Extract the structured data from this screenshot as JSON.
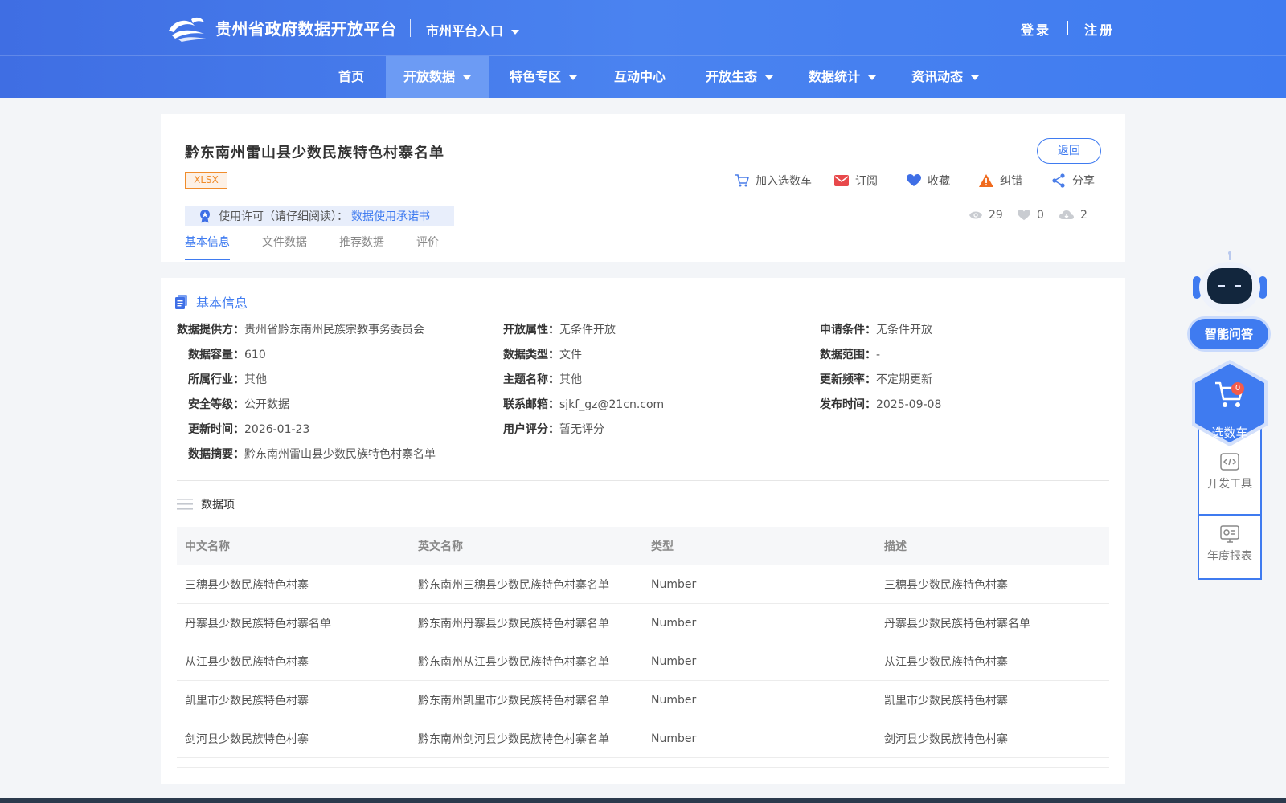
{
  "header": {
    "site_title": "贵州省政府数据开放平台",
    "city_entry": "市州平台入口",
    "login": "登录",
    "register": "注册"
  },
  "nav": {
    "items": [
      {
        "label": "首页",
        "has_dropdown": false,
        "active": false
      },
      {
        "label": "开放数据",
        "has_dropdown": true,
        "active": true
      },
      {
        "label": "特色专区",
        "has_dropdown": true,
        "active": false
      },
      {
        "label": "互动中心",
        "has_dropdown": false,
        "active": false
      },
      {
        "label": "开放生态",
        "has_dropdown": true,
        "active": false
      },
      {
        "label": "数据统计",
        "has_dropdown": true,
        "active": false
      },
      {
        "label": "资讯动态",
        "has_dropdown": true,
        "active": false
      }
    ]
  },
  "dataset": {
    "title": "黔东南州雷山县少数民族特色村寨名单",
    "format": "XLSX",
    "back_label": "返回",
    "actions": {
      "cart": "加入选数车",
      "subscribe": "订阅",
      "favorite": "收藏",
      "report": "纠错",
      "share": "分享"
    },
    "license_label": "使用许可（请仔细阅读）：",
    "license_link": "数据使用承诺书",
    "stats": {
      "views": "29",
      "likes": "0",
      "downloads": "2"
    },
    "tabs": [
      "基本信息",
      "文件数据",
      "推荐数据",
      "评价"
    ]
  },
  "basic_info": {
    "section_title": "基本信息",
    "fields": {
      "provider": {
        "label": "数据提供方：",
        "value": "贵州省黔东南州民族宗教事务委员会"
      },
      "open_attr": {
        "label": "开放属性：",
        "value": "无条件开放"
      },
      "apply_cond": {
        "label": "申请条件：",
        "value": "无条件开放"
      },
      "capacity": {
        "label": "数据容量：",
        "value": "610"
      },
      "data_type": {
        "label": "数据类型：",
        "value": "文件"
      },
      "data_range": {
        "label": "数据范围：",
        "value": "-"
      },
      "industry": {
        "label": "所属行业：",
        "value": "其他"
      },
      "topic": {
        "label": "主题名称：",
        "value": "其他"
      },
      "frequency": {
        "label": "更新频率：",
        "value": "不定期更新"
      },
      "security": {
        "label": "安全等级：",
        "value": "公开数据"
      },
      "email": {
        "label": "联系邮箱：",
        "value": "sjkf_gz@21cn.com"
      },
      "publish_time": {
        "label": "发布时间：",
        "value": "2025-09-08"
      },
      "update_time": {
        "label": "更新时间：",
        "value": "2026-01-23"
      },
      "rating": {
        "label": "用户评分：",
        "value": "暂无评分"
      },
      "summary": {
        "label": "数据摘要：",
        "value": "黔东南州雷山县少数民族特色村寨名单"
      }
    }
  },
  "data_items": {
    "title": "数据项",
    "columns": [
      "中文名称",
      "英文名称",
      "类型",
      "描述"
    ],
    "rows": [
      [
        "三穗县少数民族特色村寨",
        "黔东南州三穗县少数民族特色村寨名单",
        "Number",
        "三穗县少数民族特色村寨"
      ],
      [
        "丹寨县少数民族特色村寨名单",
        "黔东南州丹寨县少数民族特色村寨名单",
        "Number",
        "丹寨县少数民族特色村寨名单"
      ],
      [
        "从江县少数民族特色村寨",
        "黔东南州从江县少数民族特色村寨名单",
        "Number",
        "从江县少数民族特色村寨"
      ],
      [
        "凯里市少数民族特色村寨",
        "黔东南州凯里市少数民族特色村寨名单",
        "Number",
        "凯里市少数民族特色村寨"
      ],
      [
        "剑河县少数民族特色村寨",
        "黔东南州剑河县少数民族特色村寨名单",
        "Number",
        "剑河县少数民族特色村寨"
      ]
    ]
  },
  "sidebar": {
    "ai_label": "智能问答",
    "cart_label": "选数车",
    "cart_count": "0",
    "devtools_label": "开发工具",
    "annual_report_label": "年度报表"
  },
  "colors": {
    "brand_blue": "#3f7bf0",
    "badge_orange": "#f08c2b",
    "alert_red": "#f45b4a"
  },
  "icons": [
    "logo-icon",
    "cart-icon",
    "mail-icon",
    "heart-icon",
    "warning-icon",
    "share-icon",
    "award-icon",
    "eye-icon",
    "cloud-download-icon",
    "doc-icon",
    "list-icon",
    "robot-icon",
    "code-icon",
    "report-icon"
  ]
}
